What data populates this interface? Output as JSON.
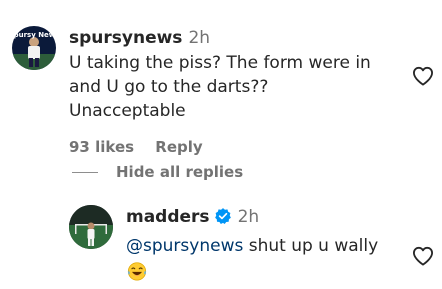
{
  "comments": [
    {
      "username": "spursynews",
      "avatar_text": "Spursy News",
      "time": "2h",
      "text_line1": "U taking the piss? The form were in",
      "text_line2": "and U go to the darts?? Unacceptable",
      "likes": "93 likes",
      "reply_label": "Reply",
      "icon": "heart-icon"
    }
  ],
  "hide_replies_label": "Hide all replies",
  "replies": [
    {
      "username": "madders",
      "verified_icon": "verified-badge-icon",
      "time": "2h",
      "mention": "@spursynews",
      "text": " shut up u wally",
      "emoji": "laughing-emoji",
      "icon": "heart-icon"
    }
  ],
  "colors": {
    "text": "#262626",
    "secondary": "#737373",
    "mention": "#00376b",
    "verified": "#0095f6"
  }
}
